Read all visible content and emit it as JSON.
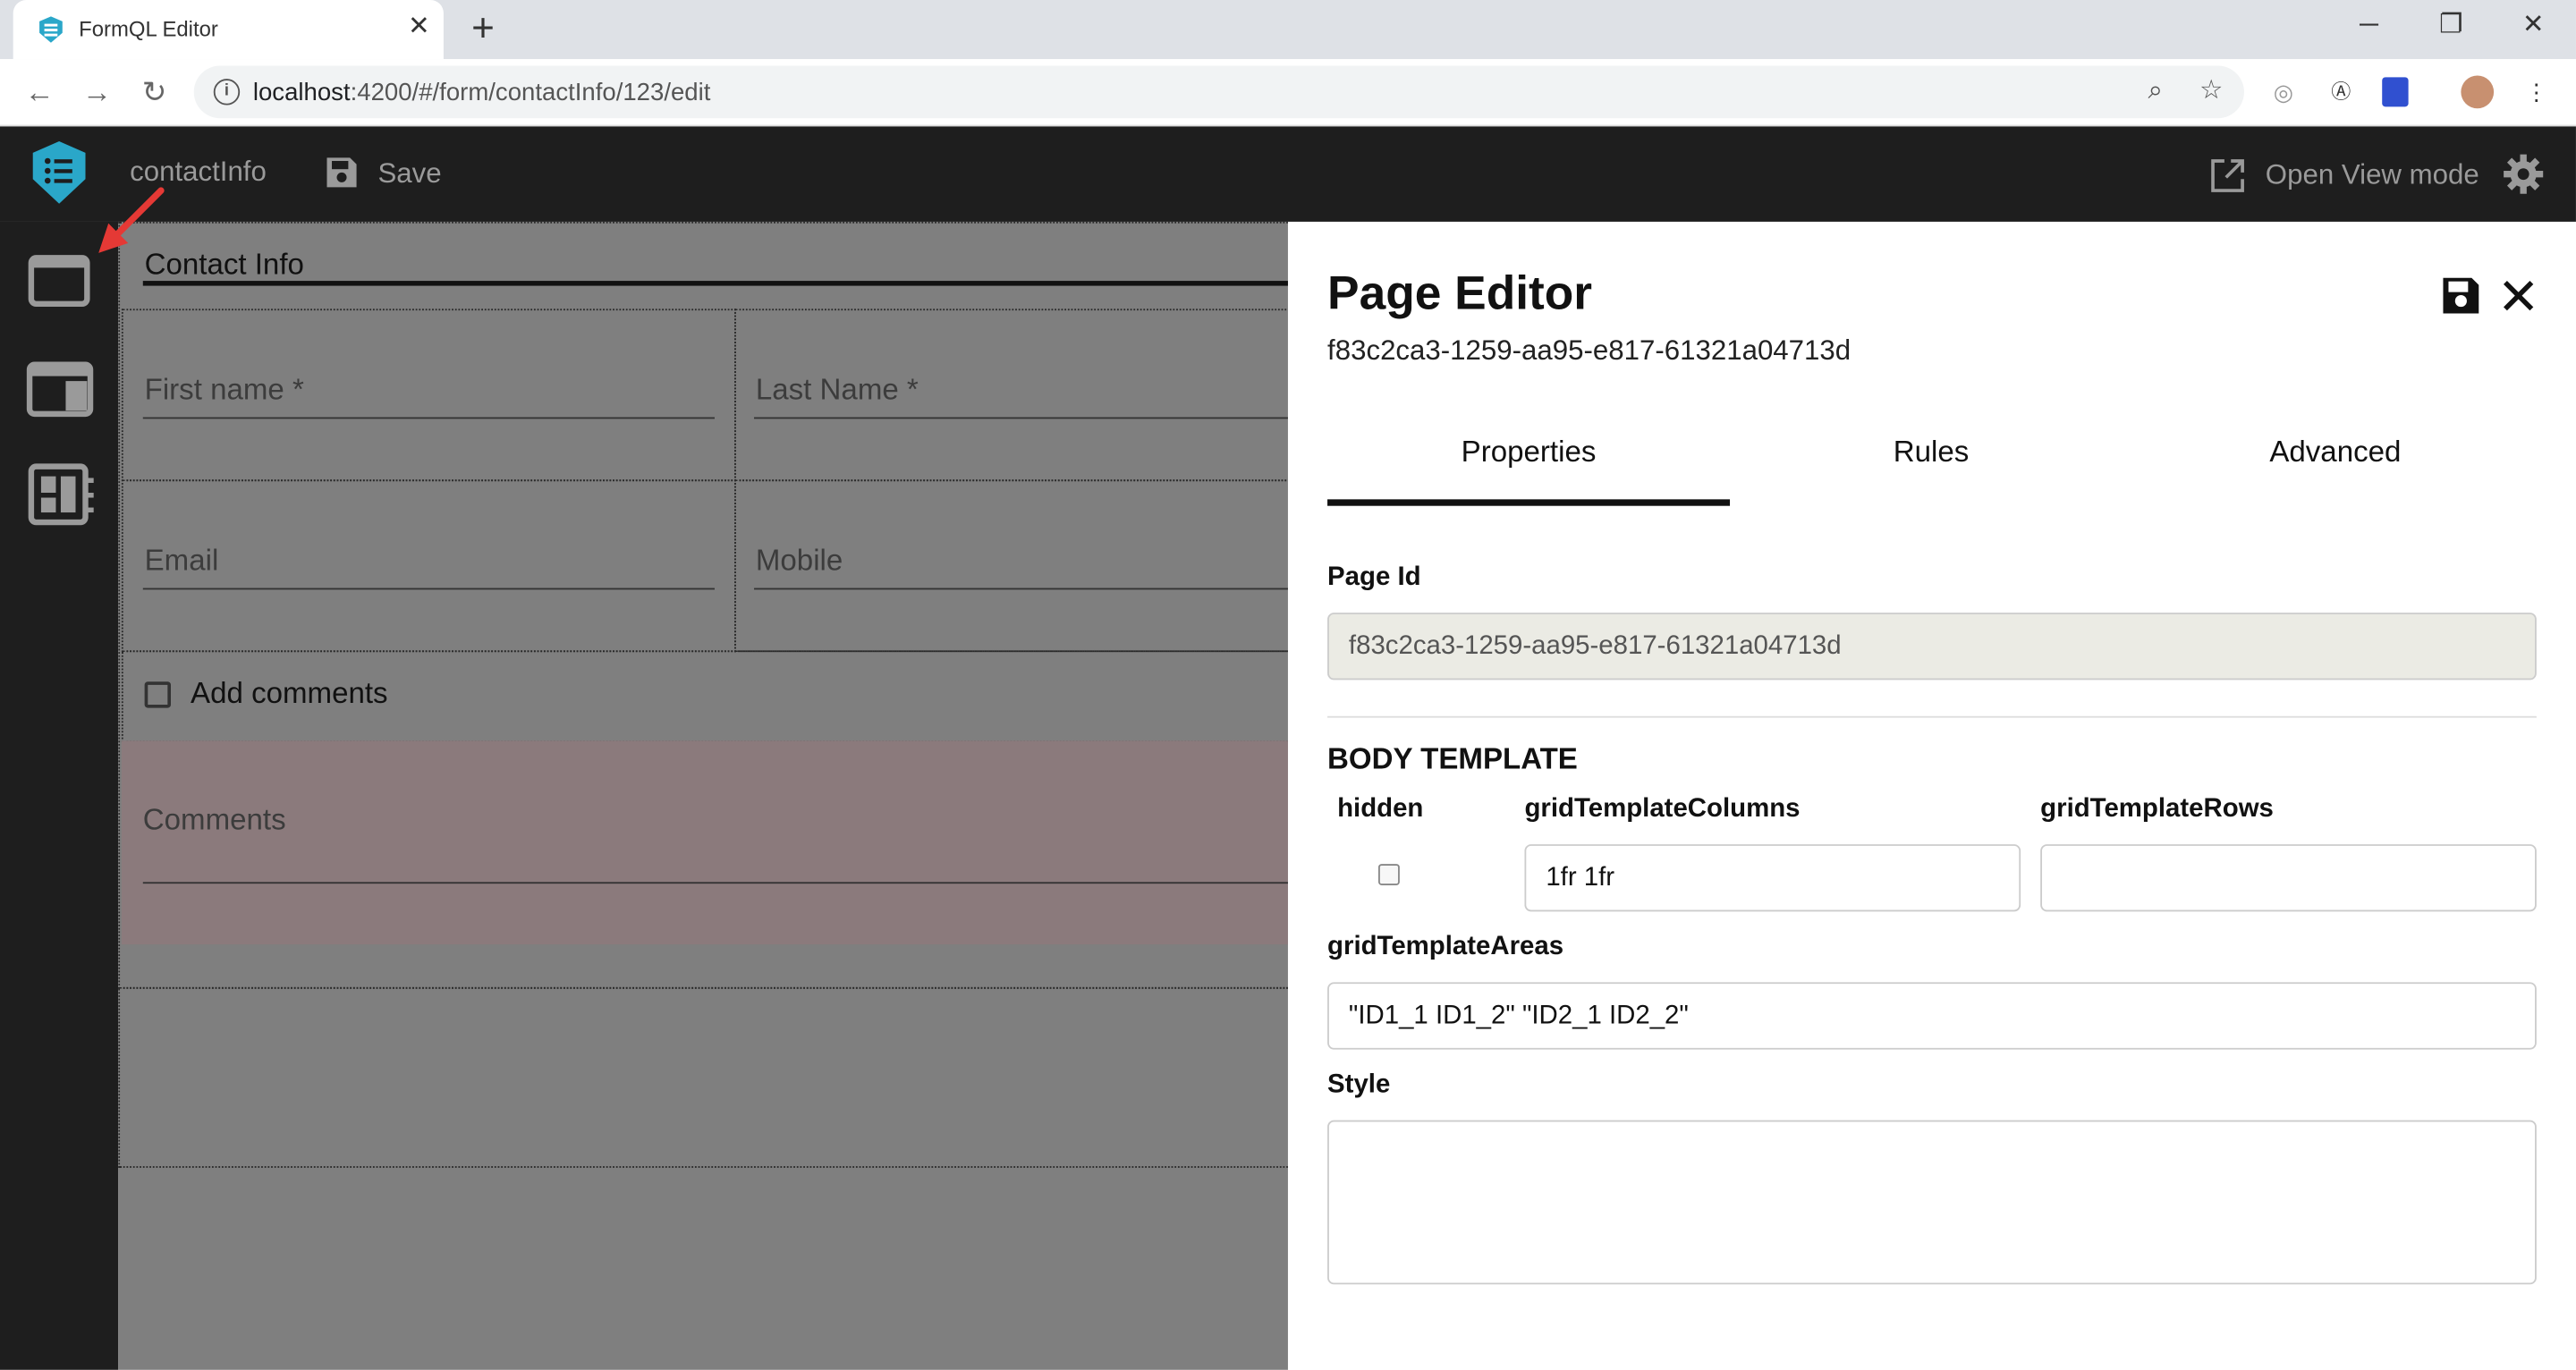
{
  "browser": {
    "tab_title": "FormQL Editor",
    "tab_close": "✕",
    "new_tab": "+",
    "url_host": "localhost",
    "url_path": ":4200/#/form/contactInfo/123/edit",
    "window_controls": {
      "minimize": "─",
      "restore": "❐",
      "close": "✕"
    }
  },
  "header": {
    "form_name": "contactInfo",
    "save_label": "Save",
    "open_view_label": "Open View mode"
  },
  "canvas": {
    "page_title": "Contact Info",
    "fields": {
      "first_name": "First name *",
      "last_name": "Last Name *",
      "email": "Email",
      "mobile": "Mobile",
      "comments": "Comments"
    },
    "checkbox_label": "Add comments"
  },
  "editor": {
    "title": "Page Editor",
    "page_uuid": "f83c2ca3-1259-aa95-e817-61321a04713d",
    "tabs": [
      "Properties",
      "Rules",
      "Advanced"
    ],
    "active_tab": "Properties",
    "page_id_label": "Page Id",
    "page_id_value": "f83c2ca3-1259-aa95-e817-61321a04713d",
    "section_title": "BODY TEMPLATE",
    "hidden_label": "hidden",
    "hidden_checked": false,
    "grid_columns_label": "gridTemplateColumns",
    "grid_columns_value": "1fr 1fr",
    "grid_rows_label": "gridTemplateRows",
    "grid_rows_value": "",
    "grid_areas_label": "gridTemplateAreas",
    "grid_areas_value": "\"ID1_1 ID1_2\" \"ID2_1 ID2_2\"",
    "style_label": "Style",
    "style_value": ""
  },
  "colors": {
    "app_bg": "#1e1e1e",
    "canvas_overlay": "#7f7f7f",
    "accent_logo": "#2aa7c9",
    "arrow": "#e53935"
  }
}
